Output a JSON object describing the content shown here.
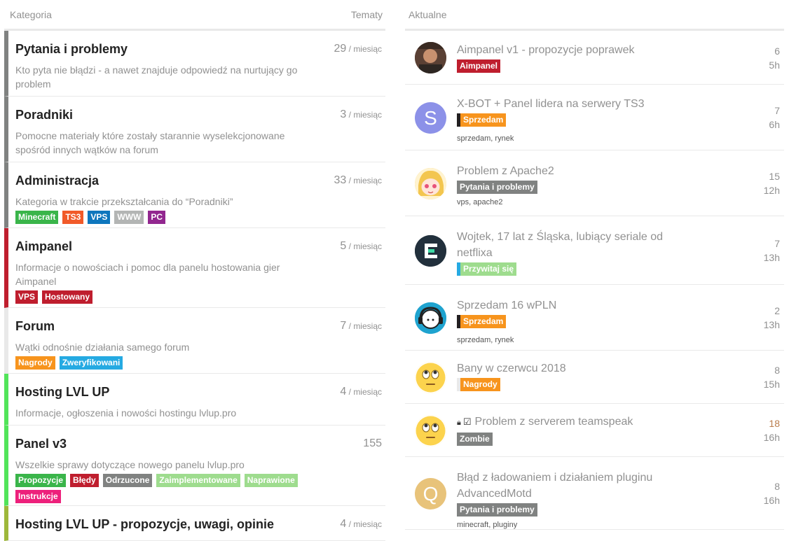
{
  "left": {
    "header": {
      "category": "Kategoria",
      "topics": "Tematy"
    },
    "categories": [
      {
        "title": "Pytania i problemy",
        "desc": "Kto pyta nie błądzi - a nawet znajduje odpowiedź na nurtujący go problem",
        "count": "29",
        "per": " / miesiąc",
        "color": "#808281",
        "badges": []
      },
      {
        "title": "Poradniki",
        "desc": "Pomocne materiały które zostały starannie wyselekcjonowane spośród innych wątków na forum",
        "count": "3",
        "per": " / miesiąc",
        "color": "#808281",
        "badges": []
      },
      {
        "title": "Administracja",
        "desc": "Kategoria w trakcie przekształcania do “Poradniki”",
        "count": "33",
        "per": " / miesiąc",
        "color": "#808281",
        "badges": [
          {
            "label": "Minecraft",
            "color": "#3ab54a"
          },
          {
            "label": "TS3",
            "color": "#f15a29"
          },
          {
            "label": "VPS",
            "color": "#0e76bd"
          },
          {
            "label": "WWW",
            "color": "#b3b5b4"
          },
          {
            "label": "PC",
            "color": "#92278f"
          }
        ]
      },
      {
        "title": "Aimpanel",
        "desc": "Informacje o nowościach i pomoc dla panelu hostowania gier Aimpanel",
        "count": "5",
        "per": " / miesiąc",
        "color": "#bf1e2e",
        "badges": [
          {
            "label": "VPS",
            "color": "#bf1e2e"
          },
          {
            "label": "Hostowany",
            "color": "#bf1e2e"
          }
        ]
      },
      {
        "title": "Forum",
        "desc": "Wątki odnośnie działania samego forum",
        "count": "7",
        "per": " / miesiąc",
        "color": "#e9e9e9",
        "badges": [
          {
            "label": "Nagrody",
            "color": "#f7941d"
          },
          {
            "label": "Zweryfikowani",
            "color": "#25aae2"
          }
        ]
      },
      {
        "title": "Hosting LVL UP",
        "desc": "Informacje, ogłoszenia i nowości hostingu lvlup.pro",
        "count": "4",
        "per": " / miesiąc",
        "color": "#52e45a",
        "badges": []
      },
      {
        "title": "Panel v3",
        "desc": "Wszelkie sprawy dotyczące nowego panelu lvlup.pro",
        "count": "155",
        "per": "",
        "color": "#52e45a",
        "badges": [
          {
            "label": "Propozycje",
            "color": "#3ab54a"
          },
          {
            "label": "Błędy",
            "color": "#bf1e2e"
          },
          {
            "label": "Odrzucone",
            "color": "#808281"
          },
          {
            "label": "Zaimplementowane",
            "color": "#9edc8e"
          },
          {
            "label": "Naprawione",
            "color": "#9edc8e"
          },
          {
            "label": "Instrukcje",
            "color": "#ed207b"
          }
        ]
      },
      {
        "title": "Hosting LVL UP - propozycje, uwagi, opinie",
        "desc": "",
        "count": "4",
        "per": " / miesiąc",
        "color": "#9eb83b",
        "badges": []
      }
    ]
  },
  "right": {
    "header": {
      "title": "Aktualne"
    },
    "topics": [
      {
        "title": "Aimpanel v1 - propozycje poprawek",
        "category": "Aimpanel",
        "cat_color": "#bf1e2e",
        "parent_color": "",
        "tags": [],
        "replies": "6",
        "age": "5h",
        "avatar": "photo-avatar",
        "avatar_letter": "",
        "avatar_color": "#6b4a3a",
        "locked": false
      },
      {
        "title": "X-BOT + Panel lidera na serwery TS3",
        "category": "Sprzedam",
        "cat_color": "#f7941d",
        "parent_color": "#231f20",
        "tags": [
          "sprzedam",
          "rynek"
        ],
        "replies": "7",
        "age": "6h",
        "avatar": "letter-avatar",
        "avatar_letter": "S",
        "avatar_color": "#8c91e8",
        "locked": false
      },
      {
        "title": "Problem z Apache2",
        "category": "Pytania i problemy",
        "cat_color": "#808281",
        "parent_color": "",
        "tags": [
          "vps",
          "apache2"
        ],
        "replies": "15",
        "age": "12h",
        "avatar": "anime-avatar",
        "avatar_letter": "",
        "avatar_color": "#f3c64f",
        "locked": false
      },
      {
        "title": "Wojtek, 17 lat z Śląska, lubiący seriale od netflixa",
        "category": "Przywitaj się",
        "cat_color": "#9edc8e",
        "parent_color": "#25aae2",
        "tags": [],
        "replies": "7",
        "age": "13h",
        "avatar": "logo-avatar",
        "avatar_letter": "",
        "avatar_color": "#22303c",
        "locked": false
      },
      {
        "title": "Sprzedam 16 wPLN",
        "category": "Sprzedam",
        "cat_color": "#f7941d",
        "parent_color": "#231f20",
        "tags": [
          "sprzedam",
          "rynek"
        ],
        "replies": "2",
        "age": "13h",
        "avatar": "headphones-avatar",
        "avatar_letter": "",
        "avatar_color": "#1fa3cf",
        "locked": false
      },
      {
        "title": "Bany w czerwcu 2018",
        "category": "Nagrody",
        "cat_color": "#f7941d",
        "parent_color": "#e9e9e9",
        "tags": [],
        "replies": "8",
        "age": "15h",
        "avatar": "emoji-avatar",
        "avatar_letter": "",
        "avatar_color": "#fcd34d",
        "locked": false
      },
      {
        "title": "Problem z serverem teamspeak",
        "category": "Zombie",
        "cat_color": "#808281",
        "parent_color": "",
        "tags": [],
        "replies": "18",
        "age": "16h",
        "avatar": "emoji-avatar",
        "avatar_letter": "",
        "avatar_color": "#fcd34d",
        "locked": true,
        "replies_color": "#b97c4b"
      },
      {
        "title": "Błąd z ładowaniem i działaniem pluginu AdvancedMotd",
        "category": "Pytania i problemy",
        "cat_color": "#808281",
        "parent_color": "",
        "tags": [
          "minecraft",
          "pluginy"
        ],
        "replies": "8",
        "age": "16h",
        "avatar": "letter-avatar",
        "avatar_letter": "Q",
        "avatar_color": "#e8c37a",
        "locked": false
      }
    ]
  }
}
